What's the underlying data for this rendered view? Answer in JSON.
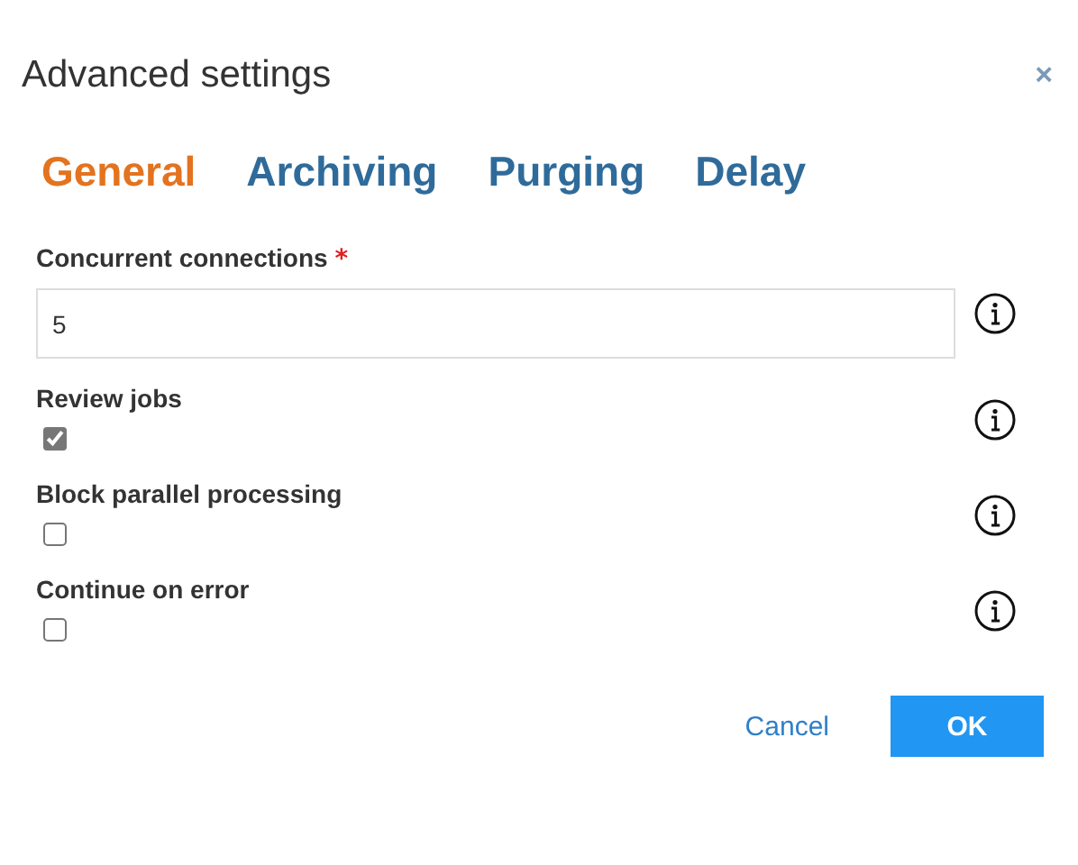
{
  "dialog": {
    "title": "Advanced settings",
    "close": "×"
  },
  "tabs": [
    {
      "label": "General",
      "selected": true
    },
    {
      "label": "Archiving",
      "selected": false
    },
    {
      "label": "Purging",
      "selected": false
    },
    {
      "label": "Delay",
      "selected": false
    }
  ],
  "fields": [
    {
      "kind": "text",
      "label": "Concurrent connections",
      "required_mark": "*",
      "value": "5"
    },
    {
      "kind": "checkbox",
      "label": "Review jobs",
      "checked": true
    },
    {
      "kind": "checkbox",
      "label": "Block parallel processing",
      "checked": false
    },
    {
      "kind": "checkbox",
      "label": "Continue on error",
      "checked": false
    }
  ],
  "buttons": {
    "cancel": "Cancel",
    "ok": "OK"
  }
}
